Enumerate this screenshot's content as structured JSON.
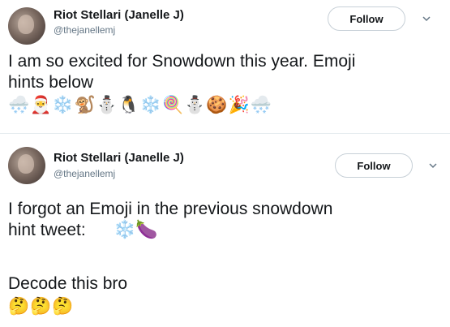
{
  "tweets": [
    {
      "display_name": "Riot Stellari (Janelle J)",
      "handle": "@thejanellemj",
      "follow_label": "Follow",
      "text": "I am so excited for Snowdown this year. Emoji\nhints below",
      "emojis": "🌨️🎅❄️🐒⛄🐧❄️🍭⛄🍪🎉🌨️"
    },
    {
      "display_name": "Riot Stellari (Janelle J)",
      "handle": "@thejanellemj",
      "follow_label": "Follow",
      "text": "I forgot an Emoji in the previous snowdown\nhint tweet:",
      "inline_emojis": "❄️🍆",
      "text2": "Decode this bro",
      "emojis": "🤔🤔🤔"
    }
  ],
  "icons": {
    "chevron": "chevron-down-icon"
  }
}
